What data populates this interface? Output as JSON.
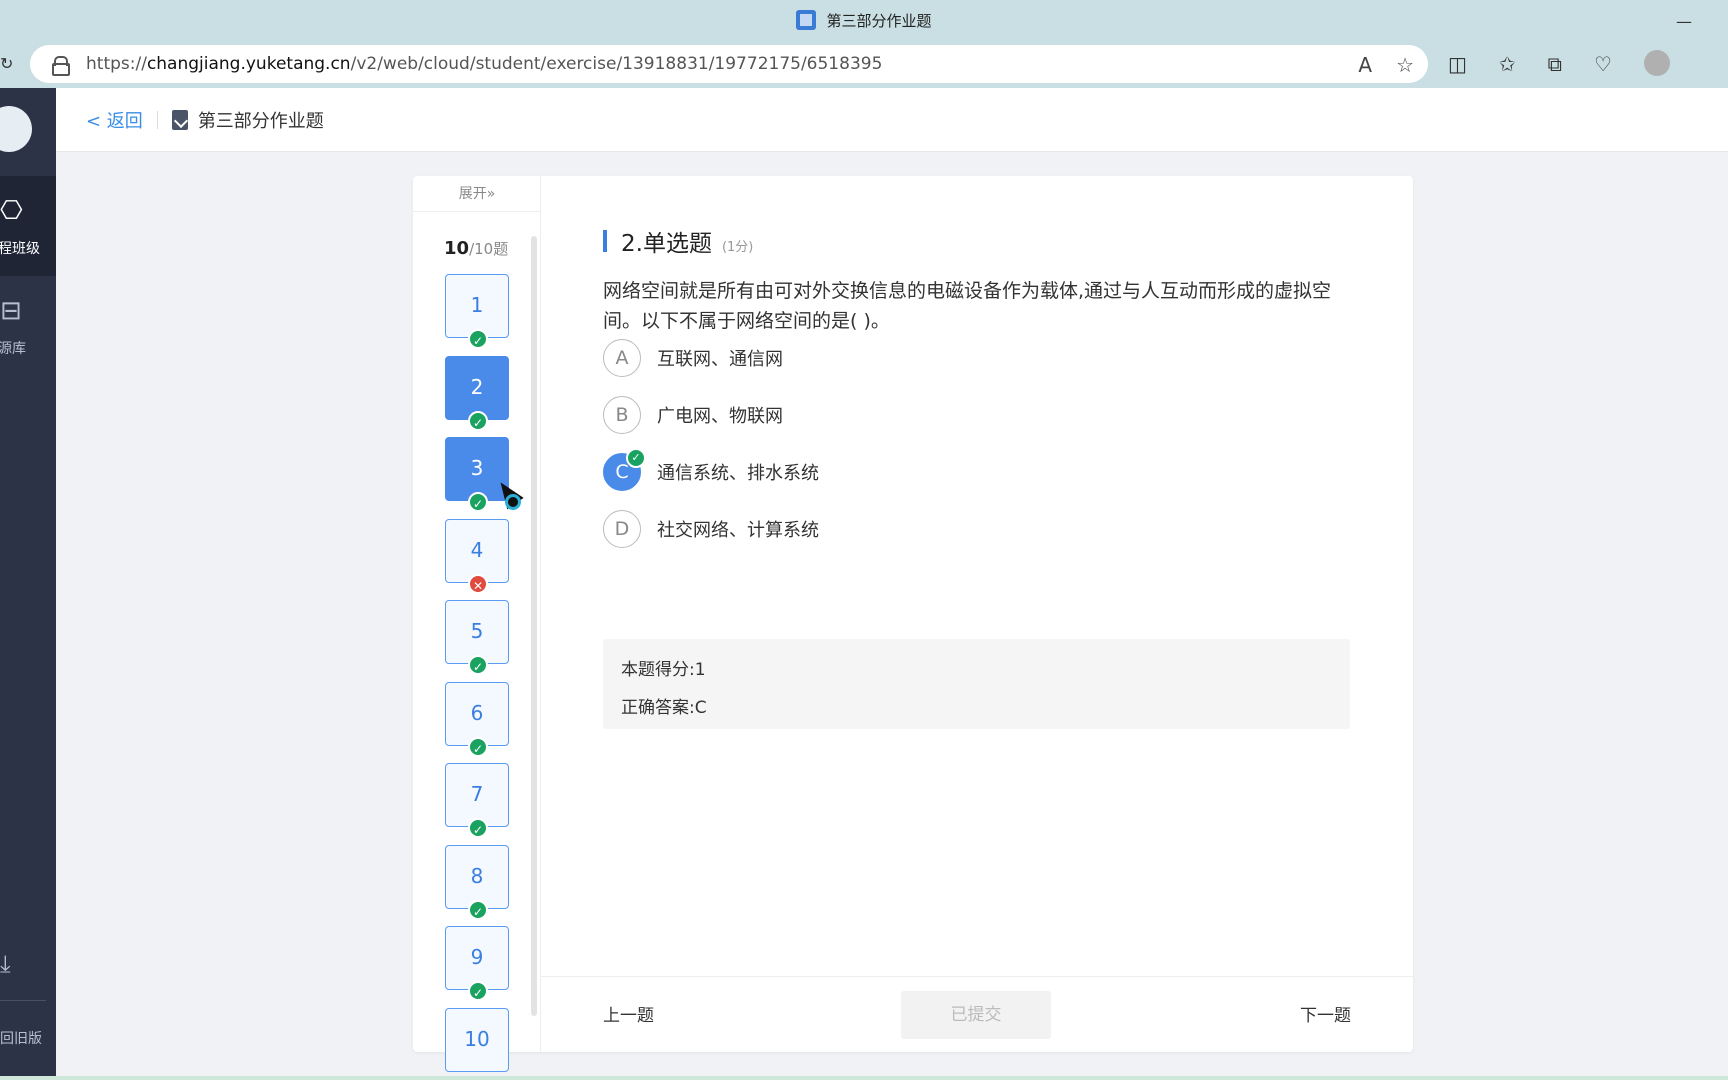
{
  "browser": {
    "tab_title": "第三部分作业题",
    "url_prefix": "https://",
    "url_domain": "changjiang.yuketang.cn",
    "url_path": "/v2/web/cloud/student/exercise/13918831/19772175/6518395"
  },
  "sidebar": {
    "items": [
      {
        "label": "程班级"
      },
      {
        "label": "源库"
      }
    ],
    "old_version": "回旧版"
  },
  "header": {
    "back": "< 返回",
    "title": "第三部分作业题"
  },
  "nav": {
    "expand": "展开»",
    "current": "10",
    "total": "/10题",
    "questions": [
      {
        "n": "1",
        "status": "correct"
      },
      {
        "n": "2",
        "status": "correct"
      },
      {
        "n": "3",
        "status": "correct"
      },
      {
        "n": "4",
        "status": "wrong"
      },
      {
        "n": "5",
        "status": "correct"
      },
      {
        "n": "6",
        "status": "correct"
      },
      {
        "n": "7",
        "status": "correct"
      },
      {
        "n": "8",
        "status": "correct"
      },
      {
        "n": "9",
        "status": "correct"
      },
      {
        "n": "10",
        "status": "none"
      }
    ]
  },
  "question": {
    "title": "2.单选题",
    "points": "(1分)",
    "stem": "网络空间就是所有由可对外交换信息的电磁设备作为载体,通过与人互动而形成的虚拟空间。以下不属于网络空间的是( )。",
    "options": [
      {
        "letter": "A",
        "text": "互联网、通信网"
      },
      {
        "letter": "B",
        "text": "广电网、物联网"
      },
      {
        "letter": "C",
        "text": "通信系统、排水系统"
      },
      {
        "letter": "D",
        "text": "社交网络、计算系统"
      }
    ],
    "score_label": "本题得分:",
    "score_value": "1",
    "answer_label": "正确答案:",
    "answer_value": "C"
  },
  "footer": {
    "prev": "上一题",
    "submitted": "已提交",
    "next": "下一题"
  },
  "colors": {
    "accent": "#4a8bea",
    "correct": "#1aa260",
    "wrong": "#e04a3f",
    "sidebar_bg": "#2c3346"
  }
}
